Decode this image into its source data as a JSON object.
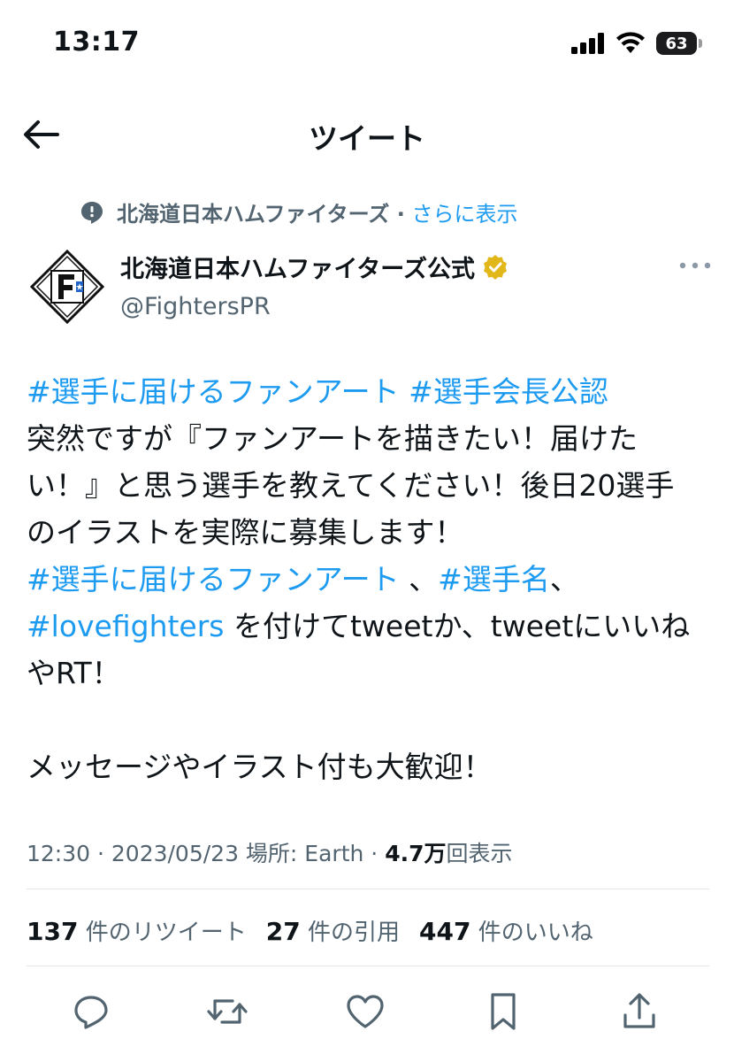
{
  "status_bar": {
    "time": "13:17",
    "battery": "63"
  },
  "nav": {
    "title": "ツイート"
  },
  "context": {
    "text": "北海道日本ハムファイターズ ·",
    "link": "さらに表示"
  },
  "author": {
    "name": "北海道日本ハムファイターズ公式",
    "handle": "@FightersPR",
    "verified_color": "#e2b719",
    "avatar_letter": "F"
  },
  "tweet": {
    "l1_tag1": "#選手に届けるファンアート",
    "l1_tag2": "#選手会長公認",
    "l2": "突然ですが『ファンアートを描きたい！届けた",
    "l3": "い！』と思う選手を教えてください！後日20選手",
    "l4": "のイラストを実際に募集します！",
    "l5_tag1": "#選手に届けるファンアート",
    "l5_sep": " 、",
    "l5_tag2": "#選手名",
    "l5_end": "、",
    "l6_tag": "#lovefighters",
    "l6_text": " を付けてtweetか、tweetにいいね",
    "l7": "やRT！",
    "l8": "メッセージやイラスト付も大歓迎！"
  },
  "meta": {
    "time": "12:30 · 2023/05/23 場所: Earth · ",
    "views_count": "4.7万",
    "views_label": "回表示"
  },
  "stats": {
    "retweets_count": "137",
    "retweets_label": "件のリツイート",
    "quotes_count": "27",
    "quotes_label": "件の引用",
    "likes_count": "447",
    "likes_label": "件のいいね"
  },
  "colors": {
    "accent": "#1d9bf0",
    "text": "#0f1419",
    "secondary": "#536471"
  },
  "icons": [
    "back-arrow-icon",
    "speech-bubble-icon",
    "verified-badge-icon",
    "more-icon",
    "reply-icon",
    "retweet-icon",
    "like-icon",
    "bookmark-icon",
    "share-icon"
  ]
}
